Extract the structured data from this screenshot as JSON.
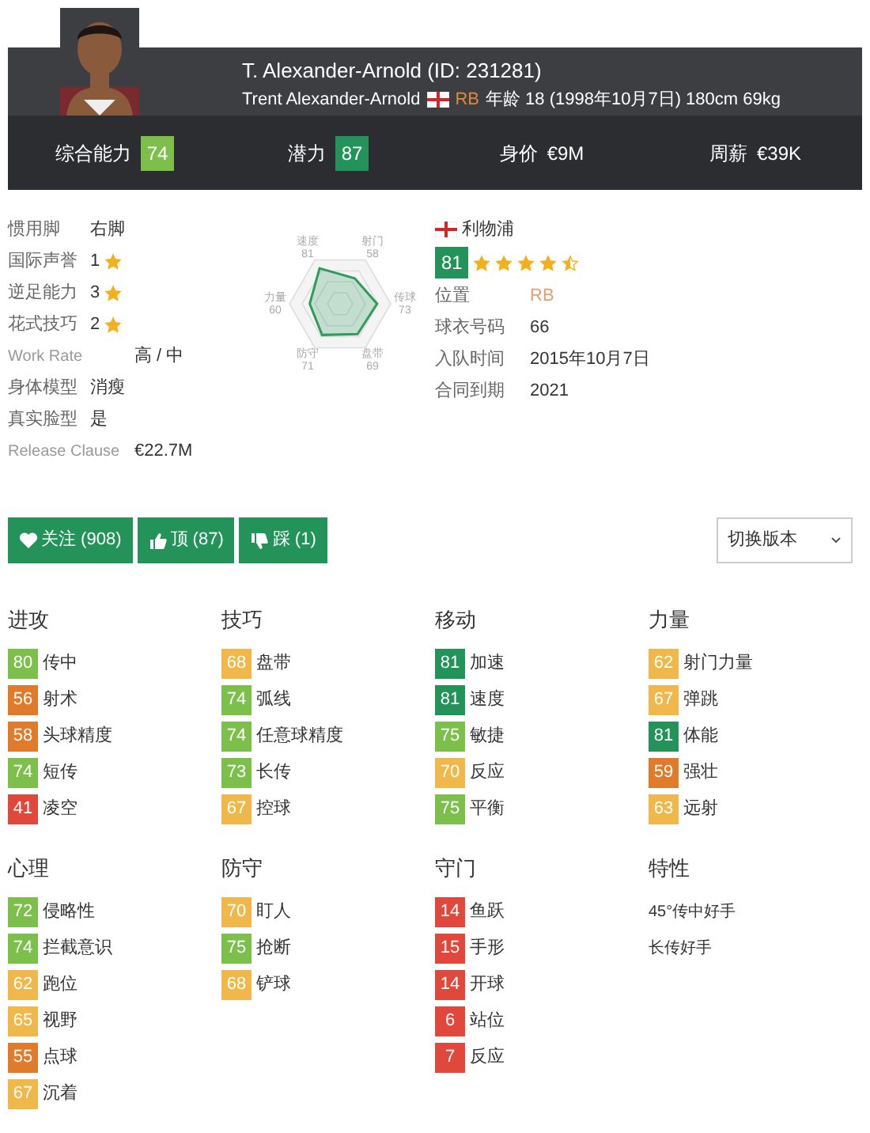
{
  "player": {
    "title": "T. Alexander-Arnold (ID: 231281)",
    "full_name": "Trent Alexander-Arnold",
    "position": "RB",
    "age_info": "年龄 18 (1998年10月7日) 180cm 69kg"
  },
  "summary": [
    {
      "label": "综合能力",
      "value": "74",
      "color": "#7cbf4b"
    },
    {
      "label": "潜力",
      "value": "87",
      "color": "#23935a"
    },
    {
      "label": "身价",
      "value": "€9M"
    },
    {
      "label": "周薪",
      "value": "€39K"
    }
  ],
  "info": [
    {
      "label": "惯用脚",
      "value": "右脚"
    },
    {
      "label": "国际声誉",
      "value": "1",
      "star": true
    },
    {
      "label": "逆足能力",
      "value": "3",
      "star": true
    },
    {
      "label": "花式技巧",
      "value": "2",
      "star": true
    },
    {
      "label": "Work Rate",
      "value": "高 / 中",
      "latin": true
    },
    {
      "label": "身体模型",
      "value": "消瘦"
    },
    {
      "label": "真实脸型",
      "value": "是"
    },
    {
      "label": "Release Clause",
      "value": "€22.7M",
      "latin": true
    }
  ],
  "radar": [
    {
      "label": "速度",
      "value": "81"
    },
    {
      "label": "射门",
      "value": "58"
    },
    {
      "label": "传球",
      "value": "73"
    },
    {
      "label": "盘带",
      "value": "69"
    },
    {
      "label": "防守",
      "value": "71"
    },
    {
      "label": "力量",
      "value": "60"
    }
  ],
  "club": {
    "name": "利物浦",
    "rating": "81",
    "stars": 4.5,
    "fields": [
      {
        "label": "位置",
        "value": "RB",
        "highlight": true
      },
      {
        "label": "球衣号码",
        "value": "66",
        "highlight": false
      },
      {
        "label": "入队时间",
        "value": "2015年10月7日",
        "highlight": false
      },
      {
        "label": "合同到期",
        "value": "2021",
        "highlight": false
      }
    ]
  },
  "actions": [
    {
      "kind": "heart",
      "label": "关注 (908)"
    },
    {
      "kind": "up",
      "label": "顶 (87)"
    },
    {
      "kind": "down",
      "label": "踩 (1)"
    }
  ],
  "version_select": {
    "value": "切换版本"
  },
  "groups": [
    {
      "title": "进攻",
      "stats": [
        {
          "value": "80",
          "label": "传中",
          "color": "#7cbf4b"
        },
        {
          "value": "56",
          "label": "射术",
          "color": "#e07b2c"
        },
        {
          "value": "58",
          "label": "头球精度",
          "color": "#e07b2c"
        },
        {
          "value": "74",
          "label": "短传",
          "color": "#7cbf4b"
        },
        {
          "value": "41",
          "label": "凌空",
          "color": "#e0483c"
        }
      ]
    },
    {
      "title": "技巧",
      "stats": [
        {
          "value": "68",
          "label": "盘带",
          "color": "#f0b84a"
        },
        {
          "value": "74",
          "label": "弧线",
          "color": "#7cbf4b"
        },
        {
          "value": "74",
          "label": "任意球精度",
          "color": "#7cbf4b"
        },
        {
          "value": "73",
          "label": "长传",
          "color": "#7cbf4b"
        },
        {
          "value": "67",
          "label": "控球",
          "color": "#f0b84a"
        }
      ]
    },
    {
      "title": "移动",
      "stats": [
        {
          "value": "81",
          "label": "加速",
          "color": "#23935a"
        },
        {
          "value": "81",
          "label": "速度",
          "color": "#23935a"
        },
        {
          "value": "75",
          "label": "敏捷",
          "color": "#7cbf4b"
        },
        {
          "value": "70",
          "label": "反应",
          "color": "#f0b84a"
        },
        {
          "value": "75",
          "label": "平衡",
          "color": "#7cbf4b"
        }
      ]
    },
    {
      "title": "力量",
      "stats": [
        {
          "value": "62",
          "label": "射门力量",
          "color": "#f0b84a"
        },
        {
          "value": "67",
          "label": "弹跳",
          "color": "#f0b84a"
        },
        {
          "value": "81",
          "label": "体能",
          "color": "#23935a"
        },
        {
          "value": "59",
          "label": "强壮",
          "color": "#e07b2c"
        },
        {
          "value": "63",
          "label": "远射",
          "color": "#f0b84a"
        }
      ]
    },
    {
      "title": "心理",
      "stats": [
        {
          "value": "72",
          "label": "侵略性",
          "color": "#7cbf4b"
        },
        {
          "value": "74",
          "label": "拦截意识",
          "color": "#7cbf4b"
        },
        {
          "value": "62",
          "label": "跑位",
          "color": "#f0b84a"
        },
        {
          "value": "65",
          "label": "视野",
          "color": "#f0b84a"
        },
        {
          "value": "55",
          "label": "点球",
          "color": "#e07b2c"
        },
        {
          "value": "67",
          "label": "沉着",
          "color": "#f0b84a"
        }
      ]
    },
    {
      "title": "防守",
      "stats": [
        {
          "value": "70",
          "label": "盯人",
          "color": "#f0b84a"
        },
        {
          "value": "75",
          "label": "抢断",
          "color": "#7cbf4b"
        },
        {
          "value": "68",
          "label": "铲球",
          "color": "#f0b84a"
        }
      ]
    },
    {
      "title": "守门",
      "stats": [
        {
          "value": "14",
          "label": "鱼跃",
          "color": "#e0483c"
        },
        {
          "value": "15",
          "label": "手形",
          "color": "#e0483c"
        },
        {
          "value": "14",
          "label": "开球",
          "color": "#e0483c"
        },
        {
          "value": "6",
          "label": "站位",
          "color": "#e0483c"
        },
        {
          "value": "7",
          "label": "反应",
          "color": "#e0483c"
        }
      ]
    },
    {
      "title": "特性",
      "traits": [
        "45°传中好手",
        "长传好手"
      ]
    }
  ]
}
